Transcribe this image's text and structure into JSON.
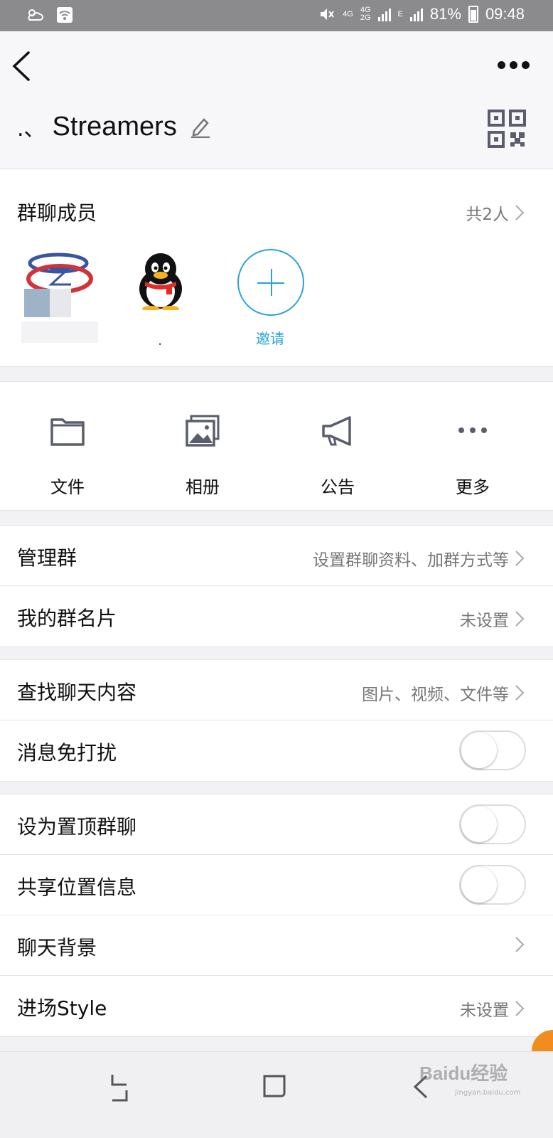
{
  "status_bar": {
    "network_1": "4G",
    "network_2_top": "4G",
    "network_2_bottom": "2G",
    "network_3": "E",
    "battery": "81%",
    "time": "09:48"
  },
  "header": {
    "title_prefix": ".、",
    "title": "Streamers"
  },
  "members": {
    "title": "群聊成员",
    "count": "共2人",
    "member2_name": ".",
    "invite_label": "邀请"
  },
  "shortcuts": [
    {
      "label": "文件",
      "icon": "folder-icon"
    },
    {
      "label": "相册",
      "icon": "album-icon"
    },
    {
      "label": "公告",
      "icon": "announcement-icon"
    },
    {
      "label": "更多",
      "icon": "more-icon"
    }
  ],
  "settings": {
    "manage": {
      "label": "管理群",
      "value": "设置群聊资料、加群方式等"
    },
    "my_card": {
      "label": "我的群名片",
      "value": "未设置"
    },
    "search": {
      "label": "查找聊天内容",
      "value": "图片、视频、文件等"
    },
    "mute": {
      "label": "消息免打扰",
      "on": false
    },
    "pin": {
      "label": "设为置顶群聊",
      "on": false
    },
    "location": {
      "label": "共享位置信息",
      "on": false
    },
    "background": {
      "label": "聊天背景"
    },
    "style": {
      "label": "进场Style",
      "value": "未设置"
    }
  },
  "watermark": {
    "text": "Baidu经验",
    "sub": "jingyan.baidu.com"
  },
  "colors": {
    "accent": "#27a3d7",
    "icon_gray": "#5a5d6e",
    "float": "#f28c1e"
  }
}
